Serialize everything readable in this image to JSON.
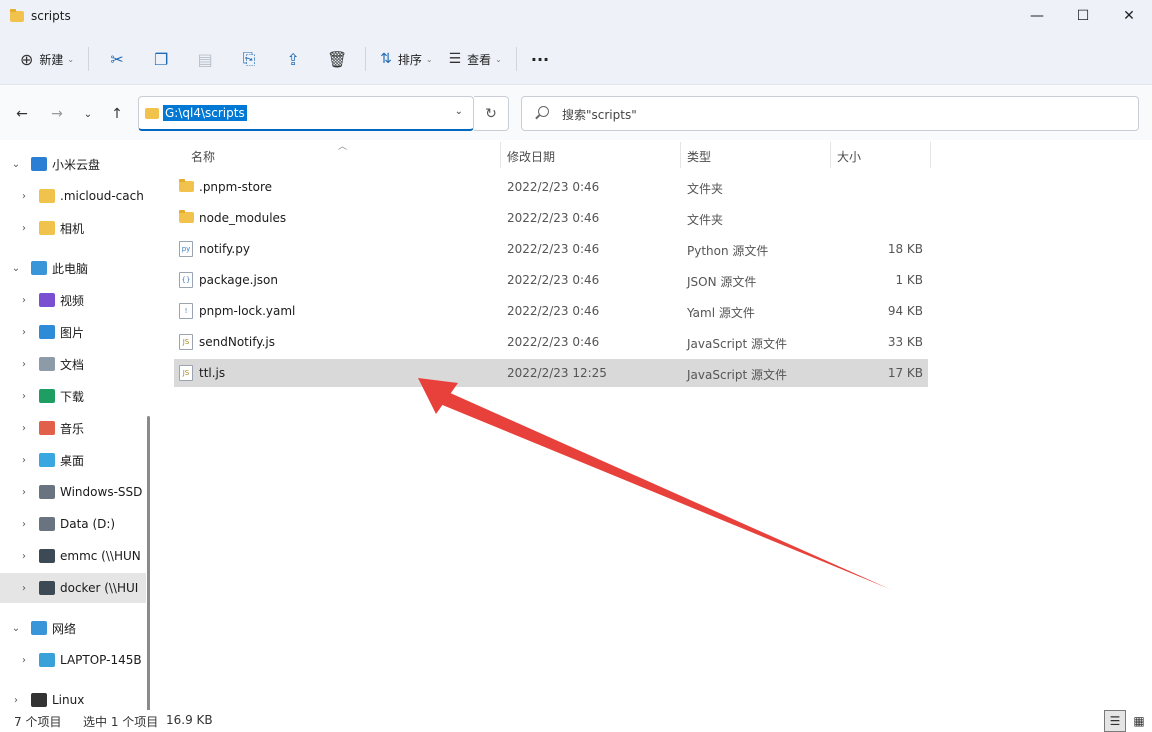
{
  "window": {
    "title": "scripts",
    "minimize": "—",
    "maximize": "☐",
    "close": "✕"
  },
  "toolbar": {
    "new_label": "新建",
    "sort_label": "排序",
    "view_label": "查看",
    "more_label": "···"
  },
  "address": {
    "path": "G:\\ql4\\scripts",
    "search_placeholder": "搜索\"scripts\""
  },
  "sidebar": {
    "items": [
      {
        "label": "小米云盘",
        "level": 0,
        "expand": "⌄"
      },
      {
        "label": ".micloud-cach",
        "level": 1,
        "expand": "›"
      },
      {
        "label": "相机",
        "level": 1,
        "expand": "›"
      },
      {
        "label": "此电脑",
        "level": 0,
        "expand": "⌄"
      },
      {
        "label": "视频",
        "level": 1,
        "expand": "›"
      },
      {
        "label": "图片",
        "level": 1,
        "expand": "›"
      },
      {
        "label": "文档",
        "level": 1,
        "expand": "›"
      },
      {
        "label": "下载",
        "level": 1,
        "expand": "›"
      },
      {
        "label": "音乐",
        "level": 1,
        "expand": "›"
      },
      {
        "label": "桌面",
        "level": 1,
        "expand": "›"
      },
      {
        "label": "Windows-SSD",
        "level": 1,
        "expand": "›"
      },
      {
        "label": "Data (D:)",
        "level": 1,
        "expand": "›"
      },
      {
        "label": "emmc (\\\\HUN",
        "level": 1,
        "expand": "›"
      },
      {
        "label": "docker (\\\\HUI",
        "level": 1,
        "expand": "›"
      },
      {
        "label": "网络",
        "level": 0,
        "expand": "⌄"
      },
      {
        "label": "LAPTOP-145B",
        "level": 1,
        "expand": "›"
      },
      {
        "label": "Linux",
        "level": 0,
        "expand": "›"
      }
    ]
  },
  "columns": {
    "name": "名称",
    "date": "修改日期",
    "type": "类型",
    "size": "大小"
  },
  "files": [
    {
      "name": ".pnpm-store",
      "date": "2022/2/23 0:46",
      "type": "文件夹",
      "size": ""
    },
    {
      "name": "node_modules",
      "date": "2022/2/23 0:46",
      "type": "文件夹",
      "size": ""
    },
    {
      "name": "notify.py",
      "date": "2022/2/23 0:46",
      "type": "Python 源文件",
      "size": "18 KB"
    },
    {
      "name": "package.json",
      "date": "2022/2/23 0:46",
      "type": "JSON 源文件",
      "size": "1 KB"
    },
    {
      "name": "pnpm-lock.yaml",
      "date": "2022/2/23 0:46",
      "type": "Yaml 源文件",
      "size": "94 KB"
    },
    {
      "name": "sendNotify.js",
      "date": "2022/2/23 0:46",
      "type": "JavaScript 源文件",
      "size": "33 KB"
    },
    {
      "name": "ttl.js",
      "date": "2022/2/23 12:25",
      "type": "JavaScript 源文件",
      "size": "17 KB"
    }
  ],
  "status": {
    "count": "7 个项目",
    "selected": "选中 1 个项目",
    "selected_size": "16.9 KB"
  },
  "colors": {
    "accent": "#0067c0",
    "annotation_arrow": "#e8403a",
    "folder": "#f2c34c"
  }
}
